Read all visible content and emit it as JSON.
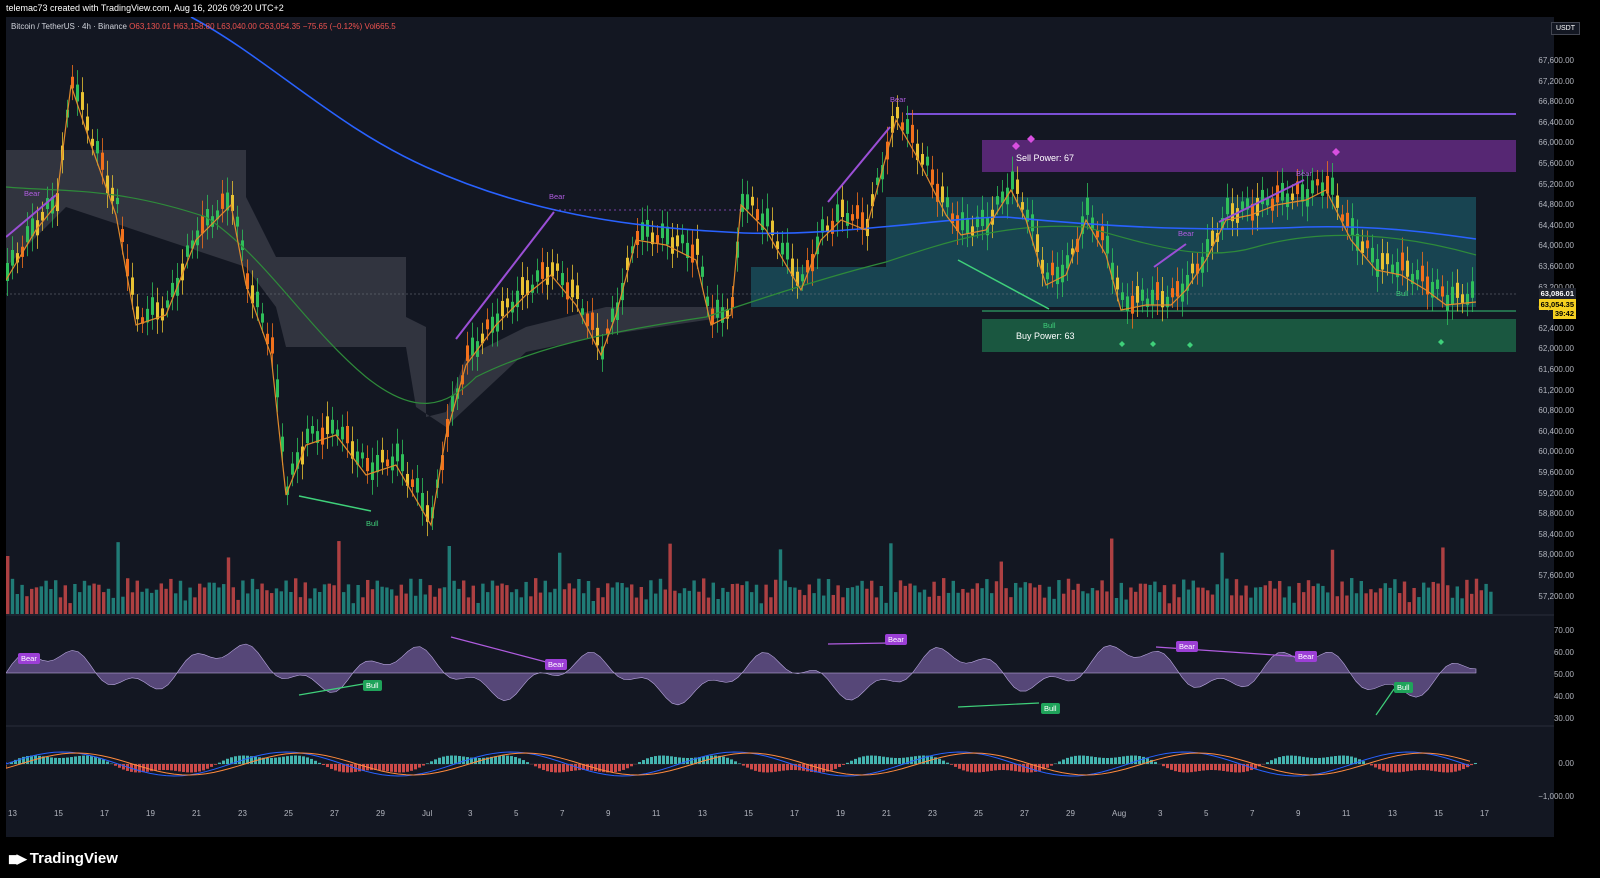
{
  "credit_line": "telemac73 created with TradingView.com, Aug 16, 2026 09:20 UTC+2",
  "legend": {
    "symbol": "Bitcoin / TetherUS · 4h · Binance",
    "open": "O63,130.01",
    "high": "H63,158.80",
    "low": "L63,040.00",
    "close": "C63,054.35",
    "change": "−75.65 (−0.12%)",
    "volume": "Vol665.5"
  },
  "currency_badge": "USDT",
  "price_axis": [
    "67,600.00",
    "67,200.00",
    "66,800.00",
    "66,400.00",
    "66,000.00",
    "65,600.00",
    "65,200.00",
    "64,800.00",
    "64,400.00",
    "64,000.00",
    "63,600.00",
    "63,200.00",
    "62,800.00",
    "62,400.00",
    "62,000.00",
    "61,600.00",
    "61,200.00",
    "60,800.00",
    "60,400.00",
    "60,000.00",
    "59,600.00",
    "59,200.00",
    "58,800.00",
    "58,400.00",
    "58,000.00",
    "57,600.00",
    "57,200.00"
  ],
  "price_tags": {
    "level": "63,086.01",
    "last": "63,054.35",
    "countdown": "39:42"
  },
  "date_axis": [
    "13",
    "15",
    "17",
    "19",
    "21",
    "23",
    "25",
    "27",
    "29",
    "Jul",
    "3",
    "5",
    "7",
    "9",
    "11",
    "13",
    "15",
    "17",
    "19",
    "21",
    "23",
    "25",
    "27",
    "29",
    "Aug",
    "3",
    "5",
    "7",
    "9",
    "11",
    "13",
    "15",
    "17"
  ],
  "zones": {
    "sell_label": "Sell Power: 67",
    "buy_label": "Buy Power: 63"
  },
  "signals": {
    "bear": "Bear",
    "bull": "Bull"
  },
  "rsi_axis": [
    "70.00",
    "60.00",
    "50.00",
    "40.00",
    "30.00"
  ],
  "macd_axis": [
    "0.00",
    "−1,000.00"
  ],
  "brand": "TradingView",
  "colors": {
    "background": "#131722",
    "up": "#26a69a",
    "down": "#ef5350",
    "ma200": "#2962ff",
    "sell_zone": "#7b2fa0",
    "buy_zone": "#1e7a52",
    "bear_signal": "#b05ce0",
    "bull_signal": "#3fd07a",
    "price_tag": "#f5d020"
  }
}
